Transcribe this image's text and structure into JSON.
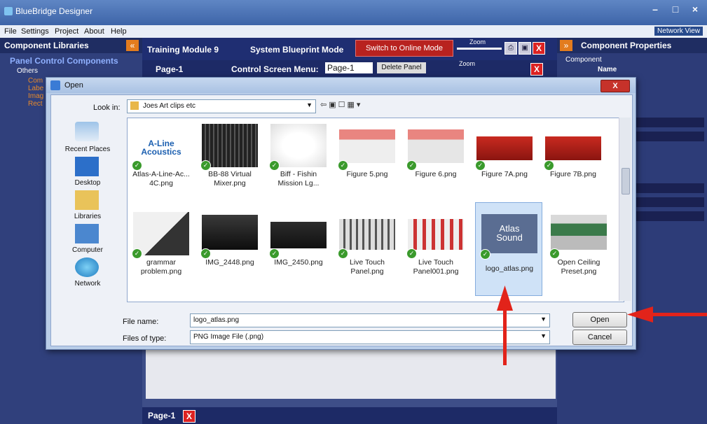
{
  "app": {
    "title": "BlueBridge Designer"
  },
  "menu": [
    "File",
    "Settings",
    "Project",
    "About",
    "Help"
  ],
  "network_view": "Network View",
  "left_pane": {
    "header": "Component Libraries",
    "category": "Panel Control Components",
    "subcategory": "Others",
    "items": [
      "Com",
      "Labe",
      "Imag",
      "Rect"
    ]
  },
  "center": {
    "module": "Training Module 9",
    "mode": "System Blueprint Mode",
    "online_button": "Switch to Online Mode",
    "zoom_label": "Zoom",
    "page_label": "Page-1",
    "menu_label": "Control Screen Menu:",
    "page_select": "Page-1",
    "delete_panel": "Delete Panel",
    "bottom_tab": "Page-1"
  },
  "right_pane": {
    "header": "Component Properties",
    "group": "Component",
    "name_label": "Name"
  },
  "dialog": {
    "title": "Open",
    "close": "X",
    "look_in_label": "Look in:",
    "look_in_value": "Joes Art clips etc",
    "places": [
      "Recent Places",
      "Desktop",
      "Libraries",
      "Computer",
      "Network"
    ],
    "files_row1": [
      {
        "name": "Atlas-A-Line-Ac...\n4C.png"
      },
      {
        "name": "BB-88 Virtual\nMixer.png"
      },
      {
        "name": "Biff - Fishin\nMission Lg..."
      },
      {
        "name": "Figure 5.png"
      },
      {
        "name": "Figure 6.png"
      },
      {
        "name": "Figure 7A.png"
      },
      {
        "name": "Figure 7B.png"
      }
    ],
    "files_row2": [
      {
        "name": "grammar\nproblem.png"
      },
      {
        "name": "IMG_2448.png"
      },
      {
        "name": "IMG_2450.png"
      },
      {
        "name": "Live Touch\nPanel.png"
      },
      {
        "name": "Live Touch\nPanel001.png"
      },
      {
        "name": "logo_atlas.png"
      },
      {
        "name": "Open Ceiling\nPreset.png"
      }
    ],
    "thumb_texts": {
      "aline": "A-Line\nAcoustics",
      "atlas": "Atlas\nSound"
    },
    "file_name_label": "File name:",
    "file_name_value": "logo_atlas.png",
    "file_type_label": "Files of type:",
    "file_type_value": "PNG Image File (.png)",
    "open_button": "Open",
    "cancel_button": "Cancel"
  },
  "colors": {
    "accent_red": "#e2231a",
    "selection": "#cfe2f7"
  }
}
